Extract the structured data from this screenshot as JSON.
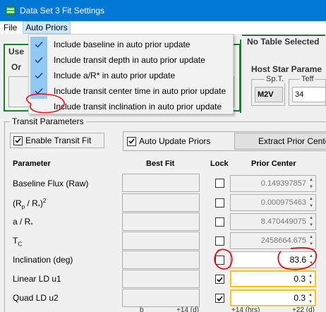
{
  "window": {
    "title": "Data Set 3 Fit Settings"
  },
  "menubar": {
    "file": "File",
    "auto_priors": "Auto Priors"
  },
  "dropdown": {
    "items": [
      {
        "label": "Include baseline in auto prior update",
        "checked": true
      },
      {
        "label": "Include transit depth in auto prior update",
        "checked": true
      },
      {
        "label": "Include a/R* in auto prior update",
        "checked": true
      },
      {
        "label": "Include transit center time in auto prior update",
        "checked": true
      },
      {
        "label": "Include transit inclination in auto prior update",
        "checked": false
      }
    ]
  },
  "background": {
    "user_label": "Use",
    "or_label": "Or",
    "no_table": "No Table Selected",
    "host_star_title": "Host Star Parame",
    "sp_t_label": "Sp.T.",
    "sp_t_value": "M2V",
    "teff_label": "Teff",
    "teff_value": "34"
  },
  "transit": {
    "title": "Transit Parameters",
    "enable_label": "Enable Transit Fit",
    "enable_checked": true,
    "auto_update_label": "Auto Update Priors",
    "auto_update_checked": true,
    "extract_button": "Extract Prior Center",
    "headers": {
      "parameter": "Parameter",
      "best_fit": "Best Fit",
      "lock": "Lock",
      "prior_center": "Prior Center"
    },
    "rows": [
      {
        "label": "Baseline Flux (Raw)",
        "prior": "0.149397857",
        "locked": false
      },
      {
        "label": "(Rp / R*)2",
        "prior": "0.000975463",
        "locked": false
      },
      {
        "label": "a / R*",
        "prior": "8.470449075",
        "locked": false
      },
      {
        "label": "TC",
        "prior": "2458664.675",
        "locked": false
      },
      {
        "label": "Inclination (deg)",
        "prior": "83.6",
        "locked": false
      },
      {
        "label": "Linear LD u1",
        "prior": "0.3",
        "locked": true
      },
      {
        "label": "Quad LD u2",
        "prior": "0.3",
        "locked": true
      }
    ],
    "bottom_hints": [
      "b",
      "+14 (d)",
      "+14 (hrs)",
      "+22 (d)"
    ]
  },
  "colors": {
    "titlebar": "#0078d7",
    "menu_hover": "#cce8ff",
    "check_column": "#90c8f6",
    "annotation": "#e0101a",
    "group_green": "#1e7e2e",
    "highlight_yellow": "#f5c518"
  }
}
